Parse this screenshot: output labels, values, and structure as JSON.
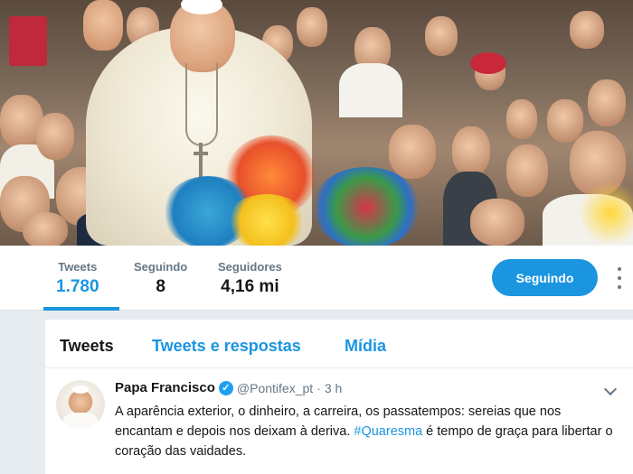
{
  "profile": {
    "stats": [
      {
        "label": "Tweets",
        "value": "1.780"
      },
      {
        "label": "Seguindo",
        "value": "8"
      },
      {
        "label": "Seguidores",
        "value": "4,16 mi"
      }
    ],
    "follow_button_label": "Seguindo"
  },
  "timeline": {
    "tabs": [
      {
        "label": "Tweets"
      },
      {
        "label": "Tweets e respostas"
      },
      {
        "label": "Mídia"
      }
    ]
  },
  "tweet": {
    "author_name": "Papa Francisco",
    "verified_glyph": "✓",
    "handle": "@Pontifex_pt",
    "separator": "·",
    "time": "3 h",
    "text_before": "A aparência exterior, o dinheiro, a carreira, os passatempos: sereias que nos encantam e depois nos deixam à deriva. ",
    "hashtag": "#Quaresma",
    "text_after": " é tempo de graça para libertar o coração das vaidades."
  },
  "colors": {
    "accent": "#1b95e0",
    "background": "#e6ecf0",
    "text": "#14171a",
    "muted": "#657786"
  },
  "icons": [
    "verified-icon",
    "chevron-down-icon",
    "more-options-icon"
  ]
}
